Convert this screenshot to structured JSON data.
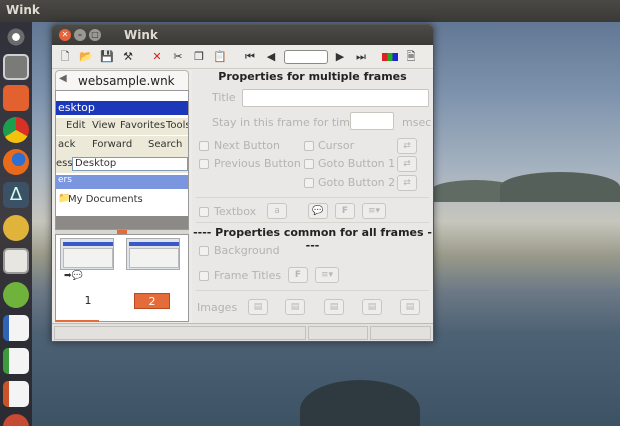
{
  "top_bar": {
    "app_name": "Wink"
  },
  "launcher": {
    "items": [
      "dash-icon",
      "files-icon",
      "folder-icon",
      "chromium-icon",
      "firefox-icon",
      "inkscape-icon",
      "wink-icon",
      "text-editor-icon",
      "recycle-icon",
      "writer-icon",
      "calc-icon",
      "impress-icon",
      "settings-icon"
    ]
  },
  "window": {
    "title": "Wink",
    "toolbar": {
      "icons": [
        "new-icon",
        "open-icon",
        "save-icon",
        "properties-icon",
        "delete-icon",
        "cut-icon",
        "copy-icon",
        "paste-icon",
        "first-frame-icon",
        "prev-frame-icon",
        "next-frame-icon",
        "last-frame-icon",
        "palette-icon",
        "render-icon"
      ]
    },
    "tab": {
      "label": "websample.wnk"
    },
    "preview": {
      "title": "esktop",
      "menu": [
        "Edit",
        "View",
        "Favorites",
        "Tools"
      ],
      "nav": {
        "back": "ack",
        "forward": "Forward",
        "search": "Search"
      },
      "address": {
        "label": "ess",
        "value": "Desktop"
      },
      "side_header": "ers",
      "item": "My Documents"
    },
    "frames": [
      {
        "number": "1",
        "selected": false
      },
      {
        "number": "2",
        "selected": true
      }
    ],
    "properties": {
      "heading": "Properties for multiple frames",
      "title_label": "Title",
      "title_value": "",
      "stay_label": "Stay in this frame for time",
      "stay_value": "",
      "stay_unit": "msec",
      "next_button": "Next Button",
      "previous_button": "Previous Button",
      "cursor": "Cursor",
      "goto_button_1": "Goto Button 1",
      "goto_button_2": "Goto Button 2",
      "textbox": "Textbox",
      "font_glyph": "F",
      "text_glyph": "a",
      "common_heading": "---- Properties common for all frames ----",
      "background": "Background",
      "frame_titles": "Frame Titles",
      "images": "Images"
    }
  }
}
